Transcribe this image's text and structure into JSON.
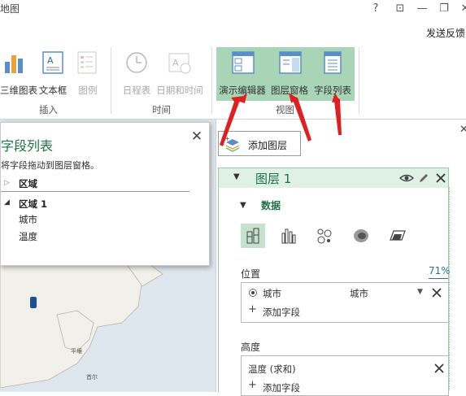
{
  "window": {
    "title": "地图",
    "help": "?",
    "controls": [
      "⊡",
      "—",
      "❐",
      "✕"
    ],
    "feedback": "发送反馈"
  },
  "ribbon": {
    "insert_group": {
      "label": "插入",
      "buttons": [
        {
          "label": "三维图表",
          "icon": "3d-chart-icon",
          "enabled": true
        },
        {
          "label": "文本框",
          "icon": "text-box-icon",
          "enabled": true
        },
        {
          "label": "图例",
          "icon": "legend-icon",
          "enabled": false
        }
      ]
    },
    "time_group": {
      "label": "时间",
      "buttons": [
        {
          "label": "日程表",
          "icon": "clock-icon",
          "enabled": false
        },
        {
          "label": "日期和时间",
          "icon": "date-time-icon",
          "enabled": false
        }
      ]
    },
    "view_group": {
      "label": "视图",
      "buttons": [
        {
          "label": "演示编辑器",
          "icon": "tour-editor-icon",
          "enabled": true
        },
        {
          "label": "图层窗格",
          "icon": "layer-pane-icon",
          "enabled": true
        },
        {
          "label": "字段列表",
          "icon": "field-list-icon",
          "enabled": true
        }
      ]
    },
    "highlight_color": "#a8d5b5"
  },
  "field_list": {
    "title": "字段列表",
    "hint": "将字段拖动到图层窗格。",
    "tables": [
      {
        "name": "区域",
        "expanded": false,
        "fields": []
      },
      {
        "name": "区域 1",
        "expanded": true,
        "fields": [
          "城市",
          "温度"
        ]
      }
    ],
    "close": "✕"
  },
  "layer_pane": {
    "add_layer_label": "添加图层",
    "layer": {
      "name": "图层 1",
      "section": "数据",
      "position": {
        "label": "位置",
        "percent": "71%",
        "field": "城市",
        "field_type": "城市",
        "add_field": "添加字段"
      },
      "height": {
        "label": "高度",
        "field": "温度 (求和)",
        "add_field": "添加字段"
      }
    },
    "accent_color": "#1e7145"
  },
  "map": {
    "labels": [
      "平壤",
      "首尔"
    ]
  }
}
